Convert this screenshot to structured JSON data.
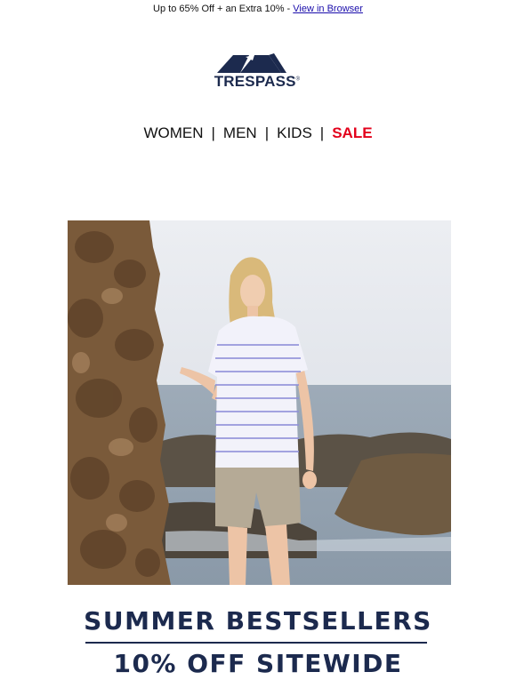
{
  "preheader": {
    "text": "Up to 65% Off + an Extra 10% - ",
    "link": "View in Browser"
  },
  "logo": {
    "text": "TRESPASS",
    "mark": "®",
    "icon": "trespass-wave-logo-icon"
  },
  "nav": {
    "items": [
      "WOMEN",
      "MEN",
      "KIDS",
      "SALE"
    ],
    "separator": "|"
  },
  "hero": {
    "icon": "hero-photo-woman-on-rocky-coast"
  },
  "headline": {
    "line1": "SUMMER BESTSELLERS",
    "line2": "10% OFF SITEWIDE"
  },
  "colors": {
    "brand_navy": "#1c2a4e",
    "sale_red": "#e3001b",
    "link_blue": "#1a0dab"
  }
}
